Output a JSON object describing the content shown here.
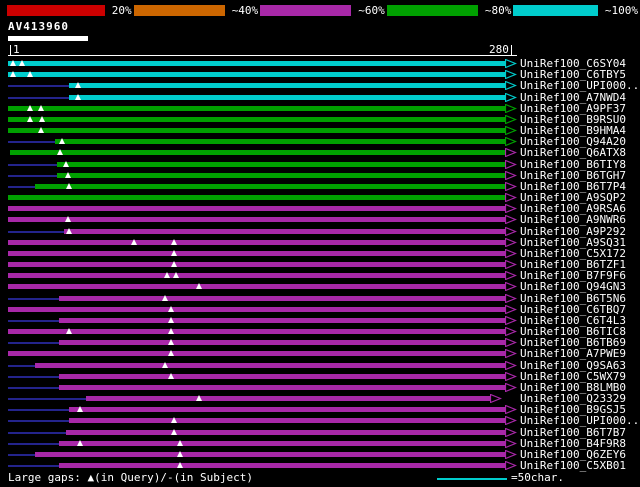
{
  "colors": {
    "cyan": "#00CCCC",
    "green": "#00A000",
    "magenta": "#A828A8",
    "red": "#CC0000",
    "orange": "#CC6600",
    "preline": "#24248C",
    "text": "#FFFFFF"
  },
  "legend": {
    "segments": [
      {
        "label": "20%",
        "color": "#CC0000"
      },
      {
        "label": "~40%",
        "color": "#CC6600"
      },
      {
        "label": "~60%",
        "color": "#A828A8"
      },
      {
        "label": "~80%",
        "color": "#00A000"
      },
      {
        "label": "~100%",
        "color": "#00CCCC"
      }
    ]
  },
  "query": {
    "name": "AV413960",
    "scale_start": "1",
    "scale_end": "280"
  },
  "hits": [
    {
      "label": "UniRef100_C6SY04",
      "color": "cyan",
      "start": 1,
      "end": 276,
      "gaps": [
        4,
        9
      ],
      "preline": false
    },
    {
      "label": "UniRef100_C6TBY5",
      "color": "cyan",
      "start": 1,
      "end": 276,
      "gaps": [
        4,
        13
      ],
      "preline": false
    },
    {
      "label": "UniRef100_UPI000..",
      "color": "cyan",
      "start": 35,
      "end": 276,
      "gaps": [
        40
      ],
      "preline": true
    },
    {
      "label": "UniRef100_A7NWD4",
      "color": "cyan",
      "start": 35,
      "end": 276,
      "gaps": [
        40
      ],
      "preline": true
    },
    {
      "label": "UniRef100_A9PF37",
      "color": "green",
      "start": 1,
      "end": 276,
      "gaps": [
        13,
        19
      ],
      "preline": false
    },
    {
      "label": "UniRef100_B9RSU0",
      "color": "green",
      "start": 1,
      "end": 276,
      "gaps": [
        13,
        20
      ],
      "preline": false
    },
    {
      "label": "UniRef100_B9HMA4",
      "color": "green",
      "start": 1,
      "end": 276,
      "gaps": [
        19
      ],
      "preline": false
    },
    {
      "label": "UniRef100_Q94A20",
      "color": "green",
      "start": 27,
      "end": 276,
      "gaps": [
        31
      ],
      "preline": true
    },
    {
      "label": "UniRef100_Q6ATX8",
      "color": "green",
      "start": 2,
      "end": 276,
      "gaps": [
        30
      ],
      "preline": false,
      "arrow": "magenta"
    },
    {
      "label": "UniRef100_B6TIY8",
      "color": "green",
      "start": 28,
      "end": 276,
      "gaps": [
        33
      ],
      "preline": true,
      "arrow": "magenta"
    },
    {
      "label": "UniRef100_B6TGH7",
      "color": "green",
      "start": 28,
      "end": 276,
      "gaps": [
        34
      ],
      "preline": true,
      "arrow": "magenta"
    },
    {
      "label": "UniRef100_B6T7P4",
      "color": "green",
      "start": 16,
      "end": 276,
      "gaps": [
        35
      ],
      "preline": true,
      "arrow": "magenta"
    },
    {
      "label": "UniRef100_A9SQP2",
      "color": "green",
      "start": 1,
      "end": 276,
      "gaps": [],
      "preline": false,
      "arrow": "magenta"
    },
    {
      "label": "UniRef100_A9RSA6",
      "color": "magenta",
      "start": 1,
      "end": 276,
      "gaps": [],
      "preline": false
    },
    {
      "label": "UniRef100_A9NWR6",
      "color": "magenta",
      "start": 1,
      "end": 276,
      "gaps": [
        34
      ],
      "preline": false
    },
    {
      "label": "UniRef100_A9P292",
      "color": "magenta",
      "start": 32,
      "end": 276,
      "gaps": [
        35
      ],
      "preline": true
    },
    {
      "label": "UniRef100_A9SQ31",
      "color": "magenta",
      "start": 1,
      "end": 276,
      "gaps": [
        71,
        93
      ],
      "preline": false
    },
    {
      "label": "UniRef100_C5X172",
      "color": "magenta",
      "start": 1,
      "end": 276,
      "gaps": [
        93
      ],
      "preline": false
    },
    {
      "label": "UniRef100_B6TZF1",
      "color": "magenta",
      "start": 1,
      "end": 276,
      "gaps": [
        93
      ],
      "preline": false
    },
    {
      "label": "UniRef100_B7F9F6",
      "color": "magenta",
      "start": 1,
      "end": 276,
      "gaps": [
        89,
        94
      ],
      "preline": false
    },
    {
      "label": "UniRef100_Q94GN3",
      "color": "magenta",
      "start": 1,
      "end": 276,
      "gaps": [
        107
      ],
      "preline": false
    },
    {
      "label": "UniRef100_B6T5N6",
      "color": "magenta",
      "start": 29,
      "end": 276,
      "gaps": [
        88
      ],
      "preline": true
    },
    {
      "label": "UniRef100_C6TBQ7",
      "color": "magenta",
      "start": 1,
      "end": 276,
      "gaps": [
        91
      ],
      "preline": false
    },
    {
      "label": "UniRef100_C6T4L3",
      "color": "magenta",
      "start": 29,
      "end": 276,
      "gaps": [
        91
      ],
      "preline": true
    },
    {
      "label": "UniRef100_B6TIC8",
      "color": "magenta",
      "start": 1,
      "end": 276,
      "gaps": [
        35,
        91
      ],
      "preline": false
    },
    {
      "label": "UniRef100_B6TB69",
      "color": "magenta",
      "start": 29,
      "end": 276,
      "gaps": [
        91
      ],
      "preline": true
    },
    {
      "label": "UniRef100_A7PWE9",
      "color": "magenta",
      "start": 1,
      "end": 276,
      "gaps": [
        91
      ],
      "preline": false
    },
    {
      "label": "UniRef100_Q9SA63",
      "color": "magenta",
      "start": 16,
      "end": 276,
      "gaps": [
        88
      ],
      "preline": true
    },
    {
      "label": "UniRef100_C5WX79",
      "color": "magenta",
      "start": 29,
      "end": 276,
      "gaps": [
        91
      ],
      "preline": true
    },
    {
      "label": "UniRef100_B8LMB0",
      "color": "magenta",
      "start": 29,
      "end": 276,
      "gaps": [],
      "preline": true
    },
    {
      "label": "UniRef100_Q23329",
      "color": "magenta",
      "start": 44,
      "end": 268,
      "gaps": [
        107
      ],
      "preline": true
    },
    {
      "label": "UniRef100_B9GSJ5",
      "color": "magenta",
      "start": 35,
      "end": 276,
      "gaps": [
        41
      ],
      "preline": true
    },
    {
      "label": "UniRef100_UPI000..",
      "color": "magenta",
      "start": 35,
      "end": 276,
      "gaps": [
        93
      ],
      "preline": true
    },
    {
      "label": "UniRef100_B6T7B7",
      "color": "magenta",
      "start": 33,
      "end": 276,
      "gaps": [
        93
      ],
      "preline": true
    },
    {
      "label": "UniRef100_B4F9R8",
      "color": "magenta",
      "start": 29,
      "end": 276,
      "gaps": [
        41,
        96
      ],
      "preline": true
    },
    {
      "label": "UniRef100_Q6ZEY6",
      "color": "magenta",
      "start": 16,
      "end": 276,
      "gaps": [
        96
      ],
      "preline": true
    },
    {
      "label": "UniRef100_C5XB01",
      "color": "magenta",
      "start": 29,
      "end": 276,
      "gaps": [
        96
      ],
      "preline": true
    }
  ],
  "footer": {
    "left": "Large gaps: ▲(in Query)/-(in Subject)",
    "scale_label": "=50char."
  }
}
